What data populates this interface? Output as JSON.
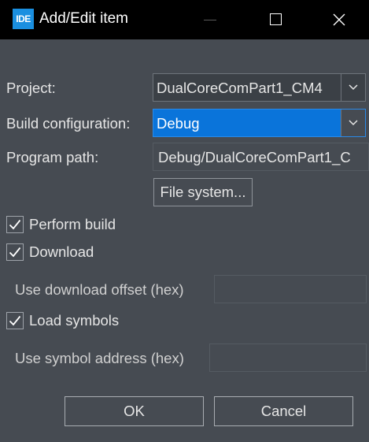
{
  "window": {
    "app_icon_text": "IDE",
    "title": "Add/Edit item"
  },
  "form": {
    "project_label": "Project:",
    "project_value": "DualCoreComPart1_CM4",
    "build_config_label": "Build configuration:",
    "build_config_value": "Debug",
    "program_path_label": "Program path:",
    "program_path_value": "Debug/DualCoreComPart1_C",
    "file_system_button": "File system...",
    "perform_build_label": "Perform build",
    "perform_build_checked": true,
    "download_label": "Download",
    "download_checked": true,
    "download_offset_label": "Use download offset (hex)",
    "download_offset_value": "",
    "load_symbols_label": "Load symbols",
    "load_symbols_checked": true,
    "symbol_address_label": "Use symbol address (hex)",
    "symbol_address_value": ""
  },
  "footer": {
    "ok_label": "OK",
    "cancel_label": "Cancel"
  },
  "icons": {
    "minimize": "minimize-icon",
    "maximize": "maximize-icon",
    "close": "close-icon",
    "dropdown": "chevron-down-icon",
    "check": "check-icon"
  },
  "colors": {
    "background": "#464b52",
    "titlebar": "#000000",
    "selection": "#0a74da",
    "app_icon": "#1a8fe0"
  }
}
